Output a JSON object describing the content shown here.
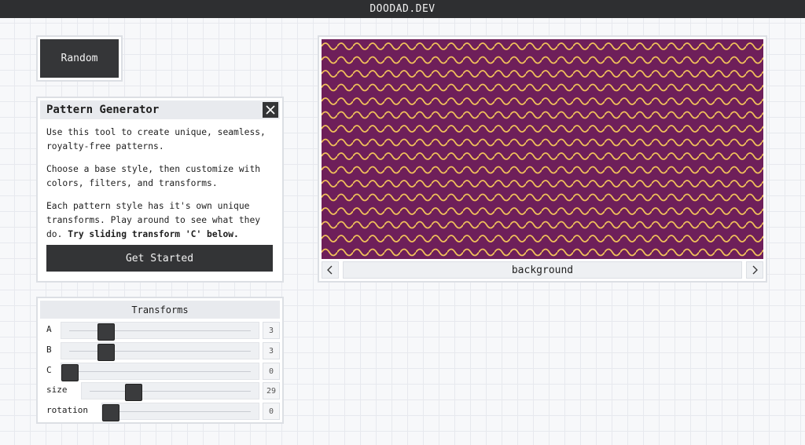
{
  "header": {
    "title": "DOODAD.DEV"
  },
  "random_button": {
    "label": "Random"
  },
  "pattern_generator": {
    "title": "Pattern Generator",
    "paragraphs": [
      "Use this tool to create unique, seamless, royalty-free patterns.",
      "Choose a base style, then customize with colors, filters, and transforms.",
      "Each pattern style has it's own unique transforms. Play around to see what they do. "
    ],
    "emphasis": "Try sliding transform 'C' below.",
    "start_label": "Get Started"
  },
  "transforms": {
    "title": "Transforms",
    "rows": [
      {
        "label": "A",
        "value": "3",
        "fraction": 0.2
      },
      {
        "label": "B",
        "value": "3",
        "fraction": 0.2
      },
      {
        "label": "C",
        "value": "0",
        "fraction": 0.0
      },
      {
        "label": "size",
        "value": "29",
        "fraction": 0.27
      },
      {
        "label": "rotation",
        "value": "0",
        "fraction": 0.0
      }
    ]
  },
  "preview": {
    "layer_label": "background",
    "prev_icon": "chevron-left-icon",
    "next_icon": "chevron-right-icon",
    "background_color": "#6e1f5a",
    "wave_color": "#f0c05a"
  }
}
